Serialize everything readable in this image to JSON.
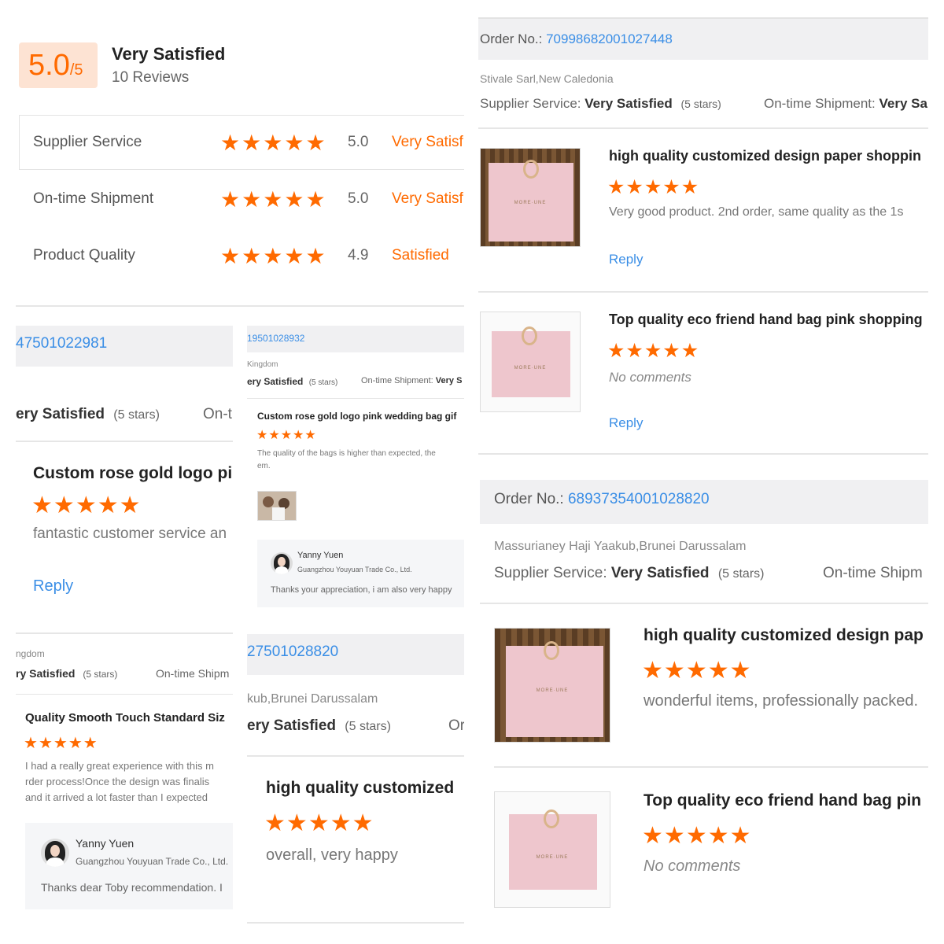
{
  "summary": {
    "score": "5.0",
    "score_max": "/5",
    "overall_label": "Very Satisfied",
    "review_count": "10 Reviews",
    "ratings": [
      {
        "label": "Supplier Service",
        "value": "5.0",
        "text": "Very Satisfied",
        "stars": 5
      },
      {
        "label": "On-time Shipment",
        "value": "5.0",
        "text": "Very Satisfied",
        "stars": 5
      },
      {
        "label": "Product Quality",
        "value": "4.9",
        "text": "Satisfied",
        "stars": 4.9
      }
    ]
  },
  "colors": {
    "accent": "#ff6a00",
    "link": "#3a8ee6",
    "score_bg": "#fde3d3"
  },
  "right_top": {
    "order_prefix": "Order No.: ",
    "order_no": "70998682001027448",
    "buyer": "Stivale Sarl,New Caledonia",
    "supplier_label": "Supplier Service:",
    "supplier_value": "Very Satisfied",
    "supplier_stars": "(5 stars)",
    "shipment_label": "On-time Shipment:",
    "shipment_value": "Very Sa",
    "items": [
      {
        "title": "high quality customized design paper shoppin",
        "comment": "Very good product. 2nd order, same quality as the 1s",
        "reply": "Reply"
      },
      {
        "title": "Top quality eco friend hand bag pink shopping",
        "comment": "No comments",
        "reply": "Reply"
      }
    ]
  },
  "right_bottom": {
    "order_prefix": "Order No.: ",
    "order_no": "68937354001028820",
    "buyer": "Massurianey Haji Yaakub,Brunei Darussalam",
    "supplier_label": "Supplier Service:",
    "supplier_value": "Very Satisfied",
    "supplier_stars": "(5 stars)",
    "shipment_label": "On-time Shipm",
    "items": [
      {
        "title": "high quality customized design pap",
        "comment": "wonderful items, professionally packed."
      },
      {
        "title": "Top quality eco friend hand bag pin",
        "comment": "No comments"
      }
    ]
  },
  "left_mid": {
    "order_no": "47501022981",
    "supplier_value": "ery Satisfied",
    "supplier_stars": "(5 stars)",
    "shipment_label": "On-ti",
    "title": "Custom rose gold logo pin",
    "comment": "fantastic customer service an",
    "reply": "Reply"
  },
  "center_top": {
    "order_no": "19501028932",
    "buyer": "Kingdom",
    "supplier_value": "ery Satisfied",
    "supplier_stars": "(5 stars)",
    "shipment_label": "On-time Shipment:",
    "shipment_value": "Very S",
    "title": "Custom rose gold logo pink wedding bag gif",
    "comment_line1": "The quality of the bags is higher than expected, the",
    "comment_line2": "em.",
    "reply_name": "Yanny Yuen",
    "reply_company": "Guangzhou Youyuan Trade Co., Ltd.",
    "reply_text": "Thanks your appreciation, i am also very happy"
  },
  "left_bottom": {
    "buyer": "ngdom",
    "supplier_value": "ry Satisfied",
    "supplier_stars": "(5 stars)",
    "shipment_label": "On-time Shipm",
    "title": "Quality Smooth Touch Standard Siz",
    "comment_line1": "I had a really great experience with this m",
    "comment_line2": "rder process!Once the design was finalis",
    "comment_line3": "and it arrived a lot faster than I expected",
    "reply_name": "Yanny Yuen",
    "reply_company": "Guangzhou Youyuan Trade Co., Ltd.",
    "reply_text": "Thanks dear Toby recommendation. I"
  },
  "center_bottom": {
    "order_no": "27501028820",
    "buyer": "kub,Brunei Darussalam",
    "supplier_value": "ery Satisfied",
    "supplier_stars": "(5 stars)",
    "shipment_label": "Or",
    "title": "high quality customized",
    "comment": "overall, very happy"
  }
}
